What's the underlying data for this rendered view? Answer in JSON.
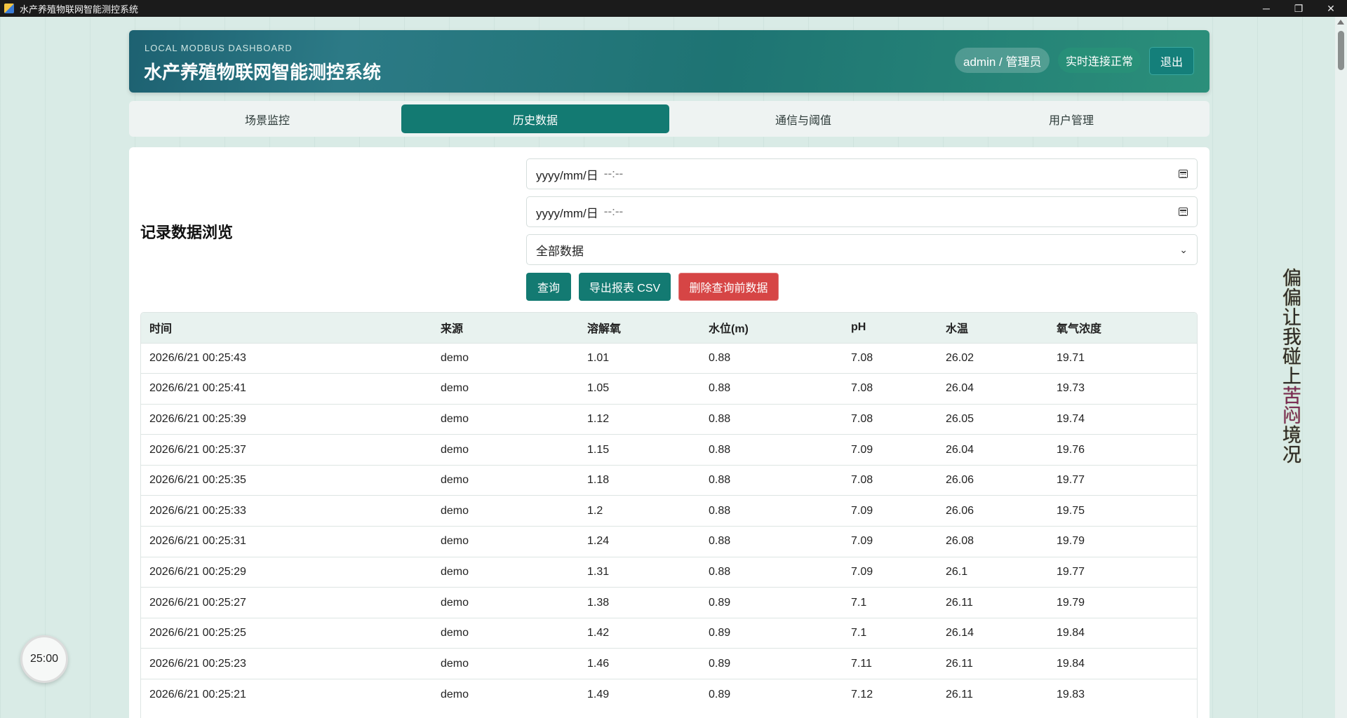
{
  "window": {
    "title": "水产养殖物联网智能测控系统",
    "minimize_glyph": "─",
    "maximize_glyph": "❐",
    "close_glyph": "✕"
  },
  "header": {
    "eyebrow": "LOCAL MODBUS DASHBOARD",
    "title": "水产养殖物联网智能测控系统",
    "user": "admin / 管理员",
    "connection_status": "实时连接正常",
    "logout_label": "退出"
  },
  "tabs": [
    {
      "label": "场景监控",
      "active": false
    },
    {
      "label": "历史数据",
      "active": true
    },
    {
      "label": "通信与阈值",
      "active": false
    },
    {
      "label": "用户管理",
      "active": false
    }
  ],
  "filters": {
    "section_title": "记录数据浏览",
    "start_time_placeholder": "yyyy/mm/日",
    "start_time_suffix": "--:--",
    "end_time_placeholder": "yyyy/mm/日",
    "end_time_suffix": "--:--",
    "source_select_value": "全部数据",
    "query_label": "查询",
    "export_label": "导出报表 CSV",
    "delete_label": "删除查询前数据"
  },
  "table": {
    "columns": [
      "时间",
      "来源",
      "溶解氧",
      "水位(m)",
      "pH",
      "水温",
      "氧气浓度"
    ],
    "rows": [
      [
        "2026/6/21 00:25:43",
        "demo",
        "1.01",
        "0.88",
        "7.08",
        "26.02",
        "19.71"
      ],
      [
        "2026/6/21 00:25:41",
        "demo",
        "1.05",
        "0.88",
        "7.08",
        "26.04",
        "19.73"
      ],
      [
        "2026/6/21 00:25:39",
        "demo",
        "1.12",
        "0.88",
        "7.08",
        "26.05",
        "19.74"
      ],
      [
        "2026/6/21 00:25:37",
        "demo",
        "1.15",
        "0.88",
        "7.09",
        "26.04",
        "19.76"
      ],
      [
        "2026/6/21 00:25:35",
        "demo",
        "1.18",
        "0.88",
        "7.08",
        "26.06",
        "19.77"
      ],
      [
        "2026/6/21 00:25:33",
        "demo",
        "1.2",
        "0.88",
        "7.09",
        "26.06",
        "19.75"
      ],
      [
        "2026/6/21 00:25:31",
        "demo",
        "1.24",
        "0.88",
        "7.09",
        "26.08",
        "19.79"
      ],
      [
        "2026/6/21 00:25:29",
        "demo",
        "1.31",
        "0.88",
        "7.09",
        "26.1",
        "19.77"
      ],
      [
        "2026/6/21 00:25:27",
        "demo",
        "1.38",
        "0.89",
        "7.1",
        "26.11",
        "19.79"
      ],
      [
        "2026/6/21 00:25:25",
        "demo",
        "1.42",
        "0.89",
        "7.1",
        "26.14",
        "19.84"
      ],
      [
        "2026/6/21 00:25:23",
        "demo",
        "1.46",
        "0.89",
        "7.11",
        "26.11",
        "19.84"
      ],
      [
        "2026/6/21 00:25:21",
        "demo",
        "1.49",
        "0.89",
        "7.12",
        "26.11",
        "19.83"
      ]
    ]
  },
  "timer": "25:00",
  "overlay_text": {
    "part1": "偏偏让我碰上",
    "part2": "苦闷",
    "part3": "境况"
  },
  "colors": {
    "accent": "#137a72",
    "danger": "#d64545",
    "background": "#d9ebe6"
  }
}
